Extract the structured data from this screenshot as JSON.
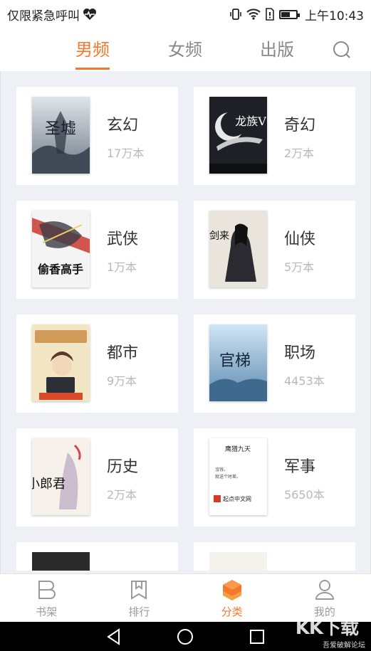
{
  "status_bar": {
    "left_text": "仅限紧急呼叫",
    "time": "上午10:43",
    "icons": [
      "heart-pulse-icon",
      "vibrate-icon",
      "wifi-icon",
      "sim-alert-icon",
      "battery-icon"
    ]
  },
  "tabs": [
    {
      "label": "男频",
      "active": true
    },
    {
      "label": "女频",
      "active": false
    },
    {
      "label": "出版",
      "active": false
    }
  ],
  "categories": [
    {
      "name": "玄幻",
      "count": "17万本",
      "cover_text": "圣墟"
    },
    {
      "name": "奇幻",
      "count": "2万本",
      "cover_text": "龙族V"
    },
    {
      "name": "武侠",
      "count": "1万本",
      "cover_text": "偷香高手"
    },
    {
      "name": "仙侠",
      "count": "5万本",
      "cover_text": "剑来"
    },
    {
      "name": "都市",
      "count": "9万本",
      "cover_text": ""
    },
    {
      "name": "职场",
      "count": "4453本",
      "cover_text": "官梯"
    },
    {
      "name": "历史",
      "count": "2万本",
      "cover_text": "小郎君"
    },
    {
      "name": "军事",
      "count": "5650本",
      "cover_text": "鹰猎九天"
    }
  ],
  "cover_extra": {
    "military_line1": "沒钱，",
    "military_line2": "就送个时差。",
    "military_brand": "起点中文网"
  },
  "bottom_nav": [
    {
      "label": "书架",
      "icon": "bookshelf-icon",
      "active": false
    },
    {
      "label": "排行",
      "icon": "bookmark-icon",
      "active": false
    },
    {
      "label": "分类",
      "icon": "category-stack-icon",
      "active": true
    },
    {
      "label": "我的",
      "icon": "person-icon",
      "active": false
    }
  ],
  "system_nav": [
    "back-icon",
    "home-icon",
    "recents-icon"
  ],
  "watermark": {
    "logo": "KK下载",
    "text": "吾爱破解论坛"
  },
  "colors": {
    "accent": "#f4782b",
    "background": "#eef0f5",
    "inactive": "#9a9a9a"
  }
}
